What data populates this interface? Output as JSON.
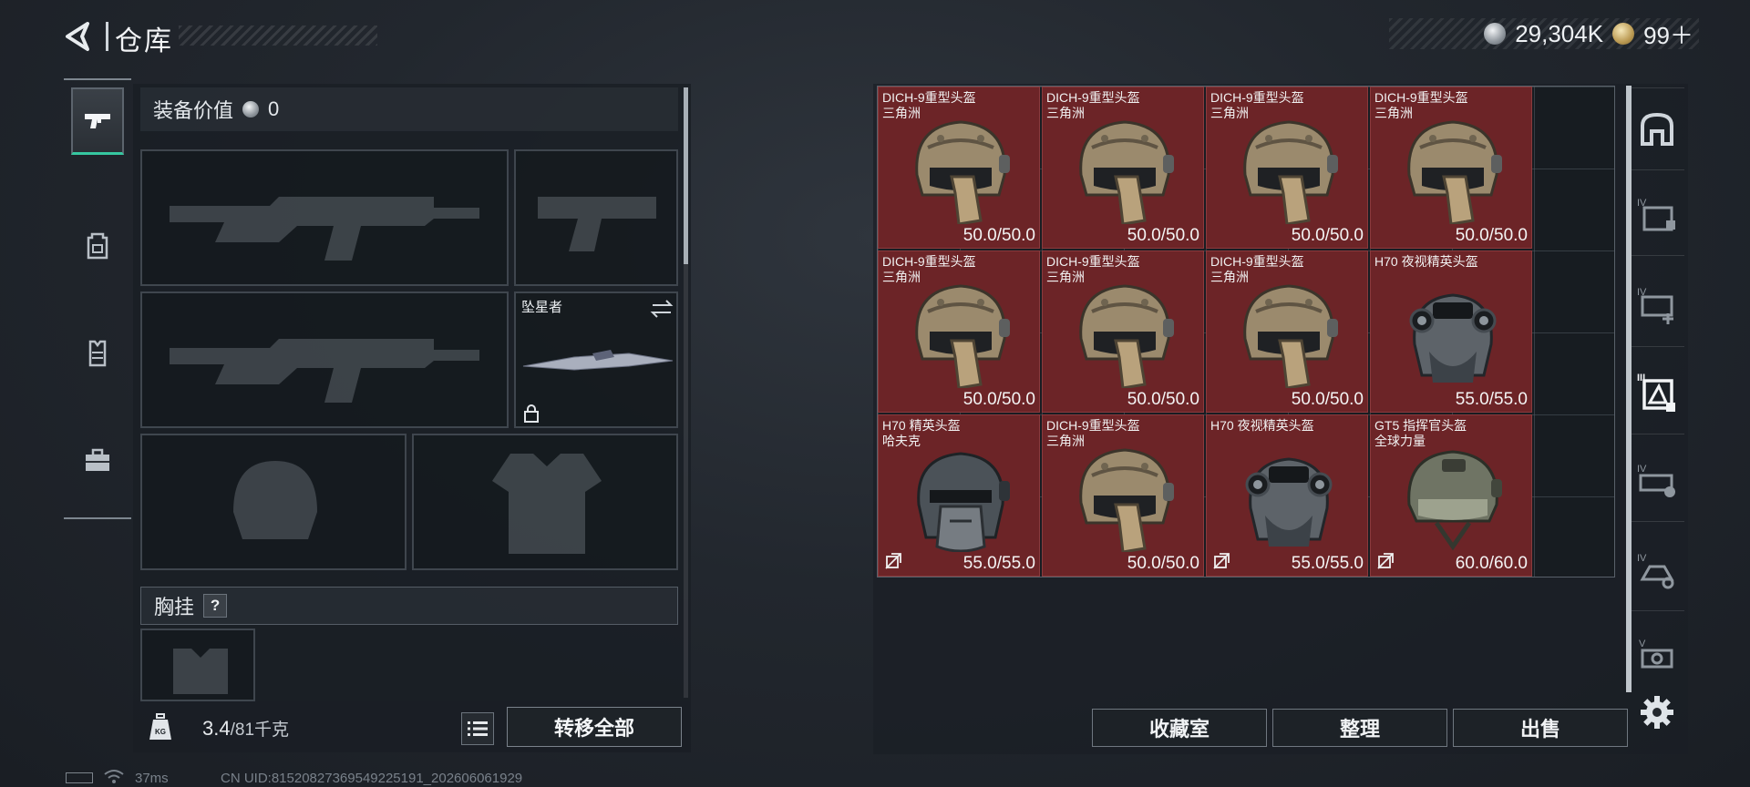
{
  "header": {
    "title": "仓库"
  },
  "currency": {
    "silver_amount": "29,304K",
    "gold_amount": "99＋"
  },
  "nav": {
    "items": [
      {
        "icon": "pistol-icon",
        "active": true
      },
      {
        "icon": "backpack-icon",
        "active": false
      },
      {
        "icon": "vest-icon",
        "active": false
      },
      {
        "icon": "toolbox-icon",
        "active": false
      }
    ]
  },
  "loadout": {
    "equip_value_label": "装备价值",
    "equip_value": "0",
    "melee_slot_name": "坠星者",
    "chest_rig_label": "胸挂",
    "help_symbol": "?",
    "weight_current": "3.4",
    "weight_max": "/81千克",
    "transfer_all_label": "转移全部"
  },
  "storage": {
    "items": [
      {
        "name": "DICH-9重型头盔",
        "sub": "三角洲",
        "durability": "50.0/50.0",
        "art": "tan",
        "marked": false
      },
      {
        "name": "DICH-9重型头盔",
        "sub": "三角洲",
        "durability": "50.0/50.0",
        "art": "tan",
        "marked": false
      },
      {
        "name": "DICH-9重型头盔",
        "sub": "三角洲",
        "durability": "50.0/50.0",
        "art": "tan",
        "marked": false
      },
      {
        "name": "DICH-9重型头盔",
        "sub": "三角洲",
        "durability": "50.0/50.0",
        "art": "tan",
        "marked": false
      },
      {
        "name": "DICH-9重型头盔",
        "sub": "三角洲",
        "durability": "50.0/50.0",
        "art": "tan",
        "marked": false
      },
      {
        "name": "DICH-9重型头盔",
        "sub": "三角洲",
        "durability": "50.0/50.0",
        "art": "tan",
        "marked": false
      },
      {
        "name": "DICH-9重型头盔",
        "sub": "三角洲",
        "durability": "50.0/50.0",
        "art": "tan",
        "marked": false
      },
      {
        "name": "H70 夜视精英头盔",
        "sub": "",
        "durability": "55.0/55.0",
        "art": "nvg",
        "marked": false
      },
      {
        "name": "H70 精英头盔",
        "sub": "哈夫克",
        "durability": "55.0/55.0",
        "art": "dark",
        "marked": true
      },
      {
        "name": "DICH-9重型头盔",
        "sub": "三角洲",
        "durability": "50.0/50.0",
        "art": "tan",
        "marked": false
      },
      {
        "name": "H70 夜视精英头盔",
        "sub": "",
        "durability": "55.0/55.0",
        "art": "nvg",
        "marked": true
      },
      {
        "name": "GT5 指挥官头盔",
        "sub": "全球力量",
        "durability": "60.0/60.0",
        "art": "olive",
        "marked": true
      }
    ]
  },
  "actions": {
    "collection_label": "收藏室",
    "sort_label": "整理",
    "sell_label": "出售"
  },
  "rail": {
    "items": [
      "storage-home-icon",
      "case-iv-icon",
      "case-iv-add-icon",
      "case-iii-selected-icon",
      "case-iv-lock-icon",
      "case-iv-gear-icon",
      "case-v-icon"
    ]
  },
  "status": {
    "ping": "37ms",
    "uid": "CN UID:815208273695492251​91_202606061929"
  },
  "colors": {
    "item_bg": "#6c2427",
    "accent": "#36c7a0"
  }
}
